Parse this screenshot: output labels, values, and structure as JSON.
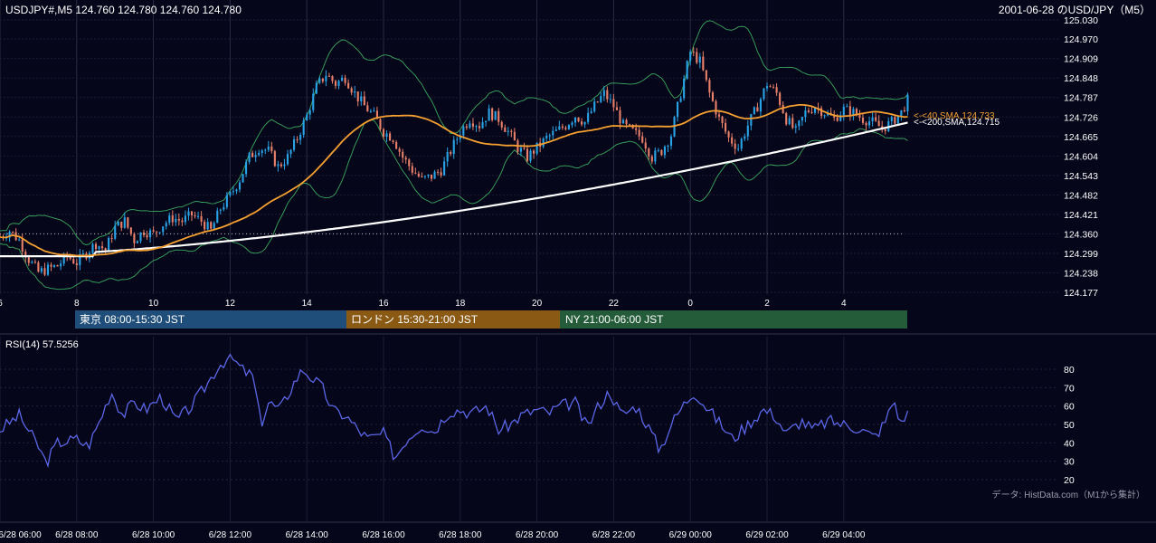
{
  "header": {
    "symbol_info": "USDJPY#,M5 124.760 124.780 124.760 124.780",
    "date_title": "2001-06-28 のUSD/JPY（M5）"
  },
  "price_axis": {
    "ticks": [
      "125.030",
      "124.970",
      "124.909",
      "124.848",
      "124.787",
      "124.726",
      "124.665",
      "124.604",
      "124.543",
      "124.482",
      "124.421",
      "124.360",
      "124.299",
      "124.238",
      "124.177"
    ]
  },
  "hour_axis": {
    "labels": [
      "6",
      "8",
      "10",
      "12",
      "14",
      "16",
      "18",
      "20",
      "22",
      "0",
      "2",
      "4"
    ]
  },
  "sessions": [
    {
      "label": "東京 08:00-15:30 JST",
      "color": "#1f4e7a"
    },
    {
      "label": "ロンドン 15:30-21:00 JST",
      "color": "#8a5a14"
    },
    {
      "label": "NY 21:00-06:00 JST",
      "color": "#245c3a"
    }
  ],
  "sma_labels": {
    "sma40": "<-<40,SMA,124.733",
    "sma200": "<-<200,SMA,124.715"
  },
  "rsi": {
    "title": "RSI(14) 57.5256",
    "ticks": [
      "80",
      "70",
      "60",
      "50",
      "40",
      "30",
      "20"
    ]
  },
  "source_note": "データ: HistData.com（M1から集計）",
  "time_axis": {
    "labels": [
      "6/28 06:00",
      "6/28 08:00",
      "6/28 10:00",
      "6/28 12:00",
      "6/28 14:00",
      "6/28 16:00",
      "6/28 18:00",
      "6/28 20:00",
      "6/28 22:00",
      "6/29 00:00",
      "6/29 02:00",
      "6/29 04:00"
    ]
  },
  "colors": {
    "background": "#06061a",
    "up_candle": "#29a3e6",
    "down_candle": "#e8806a",
    "sma40": "#f5a030",
    "sma200": "#ffffff",
    "bollinger": "#3aa860",
    "rsi_line": "#5a66e8"
  },
  "chart_data": [
    {
      "type": "candlestick",
      "title": "USDJPY#,M5 124.760 124.780 124.760 124.780",
      "timeframe": "M5",
      "x_range": [
        "6/28 06:00",
        "6/29 05:40"
      ],
      "ylim": [
        124.177,
        125.03
      ],
      "grid": true,
      "reference_line": 124.36,
      "sma40_last": 124.733,
      "sma200_last": 124.715,
      "close_points": [
        {
          "t": 0,
          "c": 124.35
        },
        {
          "t": 0.25,
          "c": 124.37
        },
        {
          "t": 0.5,
          "c": 124.34
        },
        {
          "t": 0.75,
          "c": 124.28
        },
        {
          "t": 1.0,
          "c": 124.24
        },
        {
          "t": 1.25,
          "c": 124.25
        },
        {
          "t": 1.5,
          "c": 124.26
        },
        {
          "t": 1.75,
          "c": 124.29
        },
        {
          "t": 2.0,
          "c": 124.27
        },
        {
          "t": 2.25,
          "c": 124.3
        },
        {
          "t": 2.5,
          "c": 124.33
        },
        {
          "t": 2.75,
          "c": 124.31
        },
        {
          "t": 3.0,
          "c": 124.38
        },
        {
          "t": 3.25,
          "c": 124.4
        },
        {
          "t": 3.5,
          "c": 124.34
        },
        {
          "t": 3.75,
          "c": 124.37
        },
        {
          "t": 4.0,
          "c": 124.36
        },
        {
          "t": 4.25,
          "c": 124.39
        },
        {
          "t": 4.5,
          "c": 124.41
        },
        {
          "t": 4.75,
          "c": 124.4
        },
        {
          "t": 5.0,
          "c": 124.42
        },
        {
          "t": 5.25,
          "c": 124.4
        },
        {
          "t": 5.5,
          "c": 124.37
        },
        {
          "t": 5.75,
          "c": 124.44
        },
        {
          "t": 6.0,
          "c": 124.48
        },
        {
          "t": 6.25,
          "c": 124.53
        },
        {
          "t": 6.5,
          "c": 124.6
        },
        {
          "t": 6.75,
          "c": 124.63
        },
        {
          "t": 7.0,
          "c": 124.62
        },
        {
          "t": 7.25,
          "c": 124.57
        },
        {
          "t": 7.5,
          "c": 124.6
        },
        {
          "t": 7.75,
          "c": 124.66
        },
        {
          "t": 8.0,
          "c": 124.73
        },
        {
          "t": 8.25,
          "c": 124.82
        },
        {
          "t": 8.5,
          "c": 124.86
        },
        {
          "t": 8.75,
          "c": 124.83
        },
        {
          "t": 9.0,
          "c": 124.85
        },
        {
          "t": 9.25,
          "c": 124.8
        },
        {
          "t": 9.5,
          "c": 124.76
        },
        {
          "t": 9.75,
          "c": 124.73
        },
        {
          "t": 10.0,
          "c": 124.68
        },
        {
          "t": 10.25,
          "c": 124.66
        },
        {
          "t": 10.5,
          "c": 124.6
        },
        {
          "t": 10.75,
          "c": 124.56
        },
        {
          "t": 11.0,
          "c": 124.53
        },
        {
          "t": 11.25,
          "c": 124.54
        },
        {
          "t": 11.5,
          "c": 124.56
        },
        {
          "t": 11.75,
          "c": 124.62
        },
        {
          "t": 12.0,
          "c": 124.68
        },
        {
          "t": 12.25,
          "c": 124.72
        },
        {
          "t": 12.5,
          "c": 124.7
        },
        {
          "t": 12.75,
          "c": 124.74
        },
        {
          "t": 13.0,
          "c": 124.72
        },
        {
          "t": 13.25,
          "c": 124.68
        },
        {
          "t": 13.5,
          "c": 124.63
        },
        {
          "t": 13.75,
          "c": 124.6
        },
        {
          "t": 14.0,
          "c": 124.63
        },
        {
          "t": 14.25,
          "c": 124.66
        },
        {
          "t": 14.5,
          "c": 124.68
        },
        {
          "t": 14.75,
          "c": 124.7
        },
        {
          "t": 15.0,
          "c": 124.73
        },
        {
          "t": 15.25,
          "c": 124.71
        },
        {
          "t": 15.5,
          "c": 124.76
        },
        {
          "t": 15.75,
          "c": 124.8
        },
        {
          "t": 16.0,
          "c": 124.76
        },
        {
          "t": 16.25,
          "c": 124.7
        },
        {
          "t": 16.5,
          "c": 124.68
        },
        {
          "t": 16.75,
          "c": 124.66
        },
        {
          "t": 17.0,
          "c": 124.6
        },
        {
          "t": 17.25,
          "c": 124.62
        },
        {
          "t": 17.5,
          "c": 124.67
        },
        {
          "t": 17.75,
          "c": 124.8
        },
        {
          "t": 18.0,
          "c": 124.93
        },
        {
          "t": 18.25,
          "c": 124.9
        },
        {
          "t": 18.5,
          "c": 124.8
        },
        {
          "t": 18.75,
          "c": 124.72
        },
        {
          "t": 19.0,
          "c": 124.66
        },
        {
          "t": 19.25,
          "c": 124.63
        },
        {
          "t": 19.5,
          "c": 124.7
        },
        {
          "t": 19.75,
          "c": 124.76
        },
        {
          "t": 20.0,
          "c": 124.83
        },
        {
          "t": 20.25,
          "c": 124.8
        },
        {
          "t": 20.5,
          "c": 124.72
        },
        {
          "t": 20.75,
          "c": 124.68
        },
        {
          "t": 21.0,
          "c": 124.74
        },
        {
          "t": 21.25,
          "c": 124.76
        },
        {
          "t": 21.5,
          "c": 124.74
        },
        {
          "t": 21.75,
          "c": 124.72
        },
        {
          "t": 22.0,
          "c": 124.75
        },
        {
          "t": 22.25,
          "c": 124.74
        },
        {
          "t": 22.5,
          "c": 124.72
        },
        {
          "t": 22.75,
          "c": 124.71
        },
        {
          "t": 23.0,
          "c": 124.69
        },
        {
          "t": 23.25,
          "c": 124.71
        },
        {
          "t": 23.5,
          "c": 124.74
        },
        {
          "t": 23.67,
          "c": 124.78
        }
      ]
    },
    {
      "type": "line",
      "title": "RSI(14) 57.5256",
      "ylim": [
        20,
        80
      ],
      "last_value": 57.5256,
      "points": [
        {
          "t": 0,
          "v": 47
        },
        {
          "t": 0.5,
          "v": 55
        },
        {
          "t": 1.0,
          "v": 38
        },
        {
          "t": 1.2,
          "v": 29
        },
        {
          "t": 1.5,
          "v": 40
        },
        {
          "t": 2.0,
          "v": 42
        },
        {
          "t": 2.3,
          "v": 38
        },
        {
          "t": 2.6,
          "v": 52
        },
        {
          "t": 2.9,
          "v": 68
        },
        {
          "t": 3.2,
          "v": 55
        },
        {
          "t": 3.5,
          "v": 62
        },
        {
          "t": 3.8,
          "v": 58
        },
        {
          "t": 4.2,
          "v": 65
        },
        {
          "t": 4.6,
          "v": 52
        },
        {
          "t": 5.0,
          "v": 60
        },
        {
          "t": 5.4,
          "v": 72
        },
        {
          "t": 5.7,
          "v": 82
        },
        {
          "t": 6.0,
          "v": 87
        },
        {
          "t": 6.3,
          "v": 80
        },
        {
          "t": 6.6,
          "v": 76
        },
        {
          "t": 6.8,
          "v": 50
        },
        {
          "t": 7.0,
          "v": 62
        },
        {
          "t": 7.3,
          "v": 58
        },
        {
          "t": 7.7,
          "v": 74
        },
        {
          "t": 7.9,
          "v": 80
        },
        {
          "t": 8.1,
          "v": 76
        },
        {
          "t": 8.4,
          "v": 70
        },
        {
          "t": 8.7,
          "v": 57
        },
        {
          "t": 9.0,
          "v": 55
        },
        {
          "t": 9.3,
          "v": 48
        },
        {
          "t": 9.6,
          "v": 42
        },
        {
          "t": 10.0,
          "v": 45
        },
        {
          "t": 10.3,
          "v": 32
        },
        {
          "t": 10.6,
          "v": 42
        },
        {
          "t": 11.0,
          "v": 50
        },
        {
          "t": 11.3,
          "v": 46
        },
        {
          "t": 11.7,
          "v": 57
        },
        {
          "t": 12.0,
          "v": 58
        },
        {
          "t": 12.3,
          "v": 56
        },
        {
          "t": 12.7,
          "v": 60
        },
        {
          "t": 13.0,
          "v": 47
        },
        {
          "t": 13.3,
          "v": 50
        },
        {
          "t": 13.6,
          "v": 55
        },
        {
          "t": 14.0,
          "v": 58
        },
        {
          "t": 14.3,
          "v": 56
        },
        {
          "t": 14.6,
          "v": 60
        },
        {
          "t": 15.0,
          "v": 62
        },
        {
          "t": 15.3,
          "v": 48
        },
        {
          "t": 15.6,
          "v": 60
        },
        {
          "t": 15.9,
          "v": 68
        },
        {
          "t": 16.2,
          "v": 55
        },
        {
          "t": 16.6,
          "v": 60
        },
        {
          "t": 17.0,
          "v": 45
        },
        {
          "t": 17.2,
          "v": 36
        },
        {
          "t": 17.5,
          "v": 50
        },
        {
          "t": 17.8,
          "v": 60
        },
        {
          "t": 18.1,
          "v": 68
        },
        {
          "t": 18.4,
          "v": 60
        },
        {
          "t": 18.8,
          "v": 50
        },
        {
          "t": 19.1,
          "v": 42
        },
        {
          "t": 19.5,
          "v": 50
        },
        {
          "t": 19.9,
          "v": 58
        },
        {
          "t": 20.2,
          "v": 55
        },
        {
          "t": 20.5,
          "v": 45
        },
        {
          "t": 20.9,
          "v": 52
        },
        {
          "t": 21.2,
          "v": 47
        },
        {
          "t": 21.6,
          "v": 52
        },
        {
          "t": 22.0,
          "v": 50
        },
        {
          "t": 22.4,
          "v": 48
        },
        {
          "t": 22.8,
          "v": 43
        },
        {
          "t": 23.1,
          "v": 52
        },
        {
          "t": 23.3,
          "v": 64
        },
        {
          "t": 23.5,
          "v": 50
        },
        {
          "t": 23.67,
          "v": 57.5
        }
      ]
    }
  ]
}
